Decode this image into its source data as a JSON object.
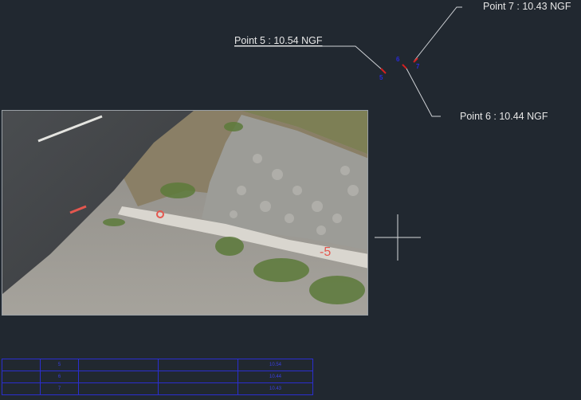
{
  "annotations": {
    "point5": "Point 5 : 10.54 NGF",
    "point6": "Point 6 : 10.44 NGF",
    "point7": "Point 7 : 10.43 NGF"
  },
  "point_numbers": {
    "p5": "5",
    "p6": "6",
    "p7": "7"
  },
  "photo_marks": [
    "-5"
  ],
  "colors": {
    "background": "#212830",
    "annotation_text": "#e6e6e6",
    "point_marker": "#d42020",
    "point_number": "#2a2ad6",
    "table_lines": "#2b2ecf"
  },
  "cursor_icon": "crosshair-cursor-icon",
  "table": {
    "rows": [
      [
        "",
        "5",
        "",
        "",
        "",
        "10.54"
      ],
      [
        "",
        "6",
        "",
        "",
        "",
        "10.44"
      ],
      [
        "",
        "7",
        "",
        "",
        "",
        "10.43"
      ]
    ]
  }
}
